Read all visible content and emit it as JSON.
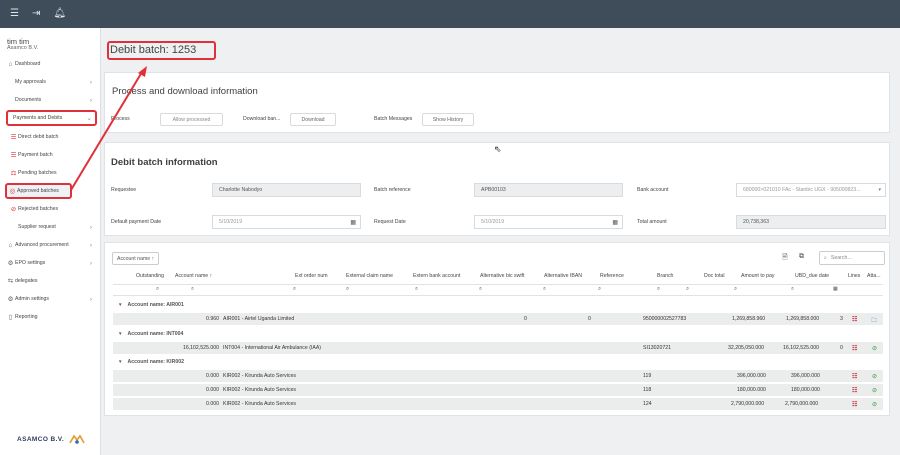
{
  "topbar": {
    "icons": [
      "menu-icon",
      "logout-icon",
      "bell-icon"
    ]
  },
  "user": {
    "name": "tim tim",
    "company": "Asamco B.V."
  },
  "sidebar": {
    "items": [
      {
        "label": "Dashboard",
        "icon": "home-icon"
      },
      {
        "label": "My approvals"
      },
      {
        "label": "Documents"
      },
      {
        "label": "Payments and Debits"
      },
      {
        "label": "Direct debit batch",
        "icon": "list-icon"
      },
      {
        "label": "Payment batch",
        "icon": "list-icon"
      },
      {
        "label": "Pending batches",
        "icon": "scale-icon"
      },
      {
        "label": "Approved batches",
        "icon": "check-circle-icon"
      },
      {
        "label": "Rejected batches",
        "icon": "reject-icon"
      },
      {
        "label": "Supplier request"
      },
      {
        "label": "Advanced procurement",
        "icon": "home-icon"
      },
      {
        "label": "EPO settings",
        "icon": "gear-icon"
      },
      {
        "label": "delegates",
        "icon": "delegates-icon"
      },
      {
        "label": "Admin settings",
        "icon": "gear-icon"
      },
      {
        "label": "Reporting",
        "icon": "document-icon"
      }
    ],
    "logo_text": "ASAMCO B.V."
  },
  "page": {
    "title": "Debit batch: 1253"
  },
  "process": {
    "title": "Process and download information",
    "process_label": "Process",
    "process_button": "Allow processed",
    "download_label": "Download ban...",
    "download_button": "Download",
    "messages_label": "Batch Messages",
    "messages_button": "Show History"
  },
  "info": {
    "title": "Debit batch information",
    "requestee_label": "Requestee",
    "requestee_value": "Charlotte Nabodyo",
    "batch_reference_label": "Batch reference",
    "batch_reference_value": "APB00103",
    "bank_account_label": "Bank account",
    "bank_account_value": "680000>021010 FAc - Stanbic UGX - 905000823...",
    "default_payment_date_label": "Default payment Date",
    "default_payment_date_value": "5/10/2019",
    "request_date_label": "Request Date",
    "request_date_value": "5/10/2019",
    "total_amount_label": "Total amount",
    "total_amount_value": "20,738,363"
  },
  "grid": {
    "group_by_chip": "Account name ↑",
    "search_placeholder": "Search...",
    "columns": {
      "outstanding": "Outstanding",
      "account_name": "Account name ↑",
      "ext_order_num": "Ext order num",
      "external_claim_name": "External claim name",
      "extern_bank_account": "Extern bank account",
      "alt_bic": "Alternative bic swift",
      "alt_iban": "Alternative IBAN",
      "reference": "Reference",
      "branch": "Branch",
      "doc_total": "Doc total",
      "amount_to_pay": "Amount to pay",
      "ubd_due_date": "UBD_due date",
      "lines": "Lines",
      "attachments": "Atta..."
    },
    "groups": [
      {
        "label": "Account name: AIR001",
        "rows": [
          {
            "outstanding": "0.960",
            "account": "AIR001 - Airtel Uganda Limited",
            "alt_bic": "0",
            "alt_iban": "0",
            "branch": "950000002527783",
            "amount_to_pay": "1,269,858.960",
            "ubd": "1,269,858.000",
            "extra": "3",
            "attach": "folder"
          }
        ]
      },
      {
        "label": "Account name: INT004",
        "rows": [
          {
            "outstanding": "16,102,525.000",
            "account": "INT004 - International Air Ambulance (IAA)",
            "alt_bic": "",
            "alt_iban": "",
            "branch": "SI13020721",
            "amount_to_pay": "32,205,050.000",
            "ubd": "16,102,525.000",
            "extra": "0",
            "attach": "link"
          }
        ]
      },
      {
        "label": "Account name: KIR002",
        "rows": [
          {
            "outstanding": "0.000",
            "account": "KIR002 - Kirunda Auto Services",
            "alt_bic": "",
            "alt_iban": "",
            "branch": "119",
            "amount_to_pay": "396,000.000",
            "ubd": "396,000.000",
            "extra": "",
            "attach": "link"
          },
          {
            "outstanding": "0.000",
            "account": "KIR002 - Kirunda Auto Services",
            "alt_bic": "",
            "alt_iban": "",
            "branch": "118",
            "amount_to_pay": "180,000.000",
            "ubd": "180,000.000",
            "extra": "",
            "attach": "link"
          },
          {
            "outstanding": "0.000",
            "account": "KIR002 - Kirunda Auto Services",
            "alt_bic": "",
            "alt_iban": "",
            "branch": "124",
            "amount_to_pay": "2,790,000.000",
            "ubd": "2,790,000.000",
            "extra": "",
            "attach": "link"
          }
        ]
      }
    ]
  },
  "colors": {
    "topbar": "#3f4d5a",
    "highlight": "#e0313a",
    "accent_icon": "#c0263a"
  }
}
